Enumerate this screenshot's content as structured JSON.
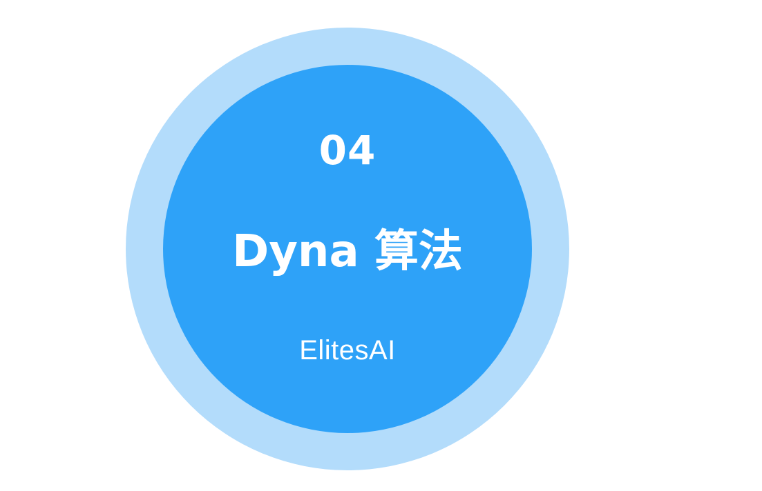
{
  "slide": {
    "number": "04",
    "title": "Dyna 算法",
    "brand": "ElitesAI"
  },
  "colors": {
    "background": "#ffffff",
    "outer_ring": "#b3dcfb",
    "inner_disc": "#2ea2f8",
    "text": "#ffffff"
  }
}
